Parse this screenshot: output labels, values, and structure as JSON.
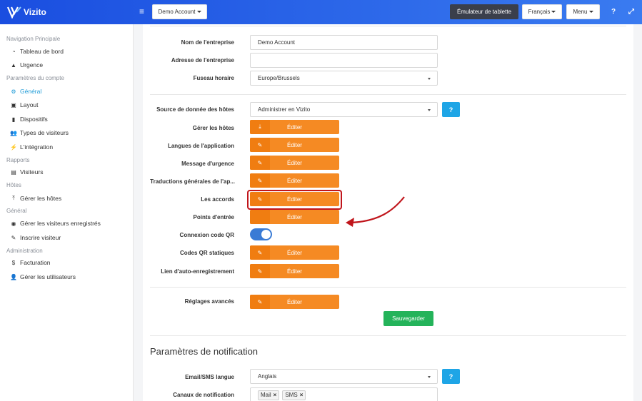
{
  "app": {
    "name": "Vizito"
  },
  "topbar": {
    "account_label": "Demo Account",
    "tablet_emulator_label": "Émulateur de tablette",
    "language_label": "Français",
    "menu_label": "Menu",
    "help_icon": "?",
    "expand_icon": "⤢",
    "hamburger_icon": "≡"
  },
  "sidebar": {
    "sections": [
      {
        "title": "Navigation Principale",
        "items": [
          {
            "label": "Tableau de bord",
            "icon": "dashboard-icon",
            "glyph": "◔"
          },
          {
            "label": "Urgence",
            "icon": "warning-icon",
            "glyph": "▲"
          }
        ]
      },
      {
        "title": "Paramètres du compte",
        "items": [
          {
            "label": "Général",
            "icon": "gear-icon",
            "glyph": "⚙",
            "active": true
          },
          {
            "label": "Layout",
            "icon": "image-icon",
            "glyph": "▣"
          },
          {
            "label": "Dispositifs",
            "icon": "tablet-icon",
            "glyph": "▮"
          },
          {
            "label": "Types de visiteurs",
            "icon": "users-icon",
            "glyph": "👥"
          },
          {
            "label": "L'intégration",
            "icon": "plug-icon",
            "glyph": "⚡"
          }
        ]
      },
      {
        "title": "Rapports",
        "items": [
          {
            "label": "Visiteurs",
            "icon": "book-icon",
            "glyph": "▤"
          }
        ]
      },
      {
        "title": "Hôtes",
        "items": [
          {
            "label": "Gérer les hôtes",
            "icon": "upload-icon",
            "glyph": "⤒"
          }
        ]
      },
      {
        "title": "Général",
        "items": [
          {
            "label": "Gérer les visiteurs enregistrés",
            "icon": "id-card-icon",
            "glyph": "◉"
          },
          {
            "label": "Inscrire visiteur",
            "icon": "pencil-icon",
            "glyph": "✎"
          }
        ]
      },
      {
        "title": "Administration",
        "items": [
          {
            "label": "Facturation",
            "icon": "dollar-icon",
            "glyph": "$"
          },
          {
            "label": "Gérer les utilisateurs",
            "icon": "user-plus-icon",
            "glyph": "👤"
          }
        ]
      }
    ]
  },
  "form": {
    "company_name": {
      "label": "Nom de l'entreprise",
      "value": "Demo Account"
    },
    "company_address": {
      "label": "Adresse de l'entreprise",
      "value": ""
    },
    "timezone": {
      "label": "Fuseau horaire",
      "value": "Europe/Brussels"
    },
    "host_data_source": {
      "label": "Source de donnée des hôtes",
      "value": "Administrer en Vizito",
      "help": "?"
    },
    "edit_rows": [
      {
        "label": "Gérer les hôtes",
        "button": "Éditer",
        "icon": "upload-icon",
        "glyph": "⤓"
      },
      {
        "label": "Langues de l'application",
        "button": "Éditer",
        "icon": "edit-icon",
        "glyph": "✎"
      },
      {
        "label": "Message d'urgence",
        "button": "Éditer",
        "icon": "edit-icon",
        "glyph": "✎"
      },
      {
        "label": "Traductions générales de l'ap...",
        "button": "Éditer",
        "icon": "edit-icon",
        "glyph": "✎"
      },
      {
        "label": "Les accords",
        "button": "Éditer",
        "icon": "edit-icon",
        "glyph": "✎"
      },
      {
        "label": "Points d'entrée",
        "button": "Éditer",
        "icon": "edit-icon",
        "glyph": ""
      }
    ],
    "qr_connection": {
      "label": "Connexion code QR",
      "enabled": true
    },
    "edit_rows_2": [
      {
        "label": "Codes QR statiques",
        "button": "Éditer",
        "icon": "edit-icon",
        "glyph": "✎"
      },
      {
        "label": "Lien d'auto-enregistrement",
        "button": "Éditer",
        "icon": "edit-icon",
        "glyph": "✎"
      }
    ],
    "advanced": {
      "label": "Réglages avancés",
      "button": "Éditer",
      "icon": "edit-icon",
      "glyph": "✎"
    },
    "save_label": "Sauvegarder"
  },
  "notifications": {
    "heading": "Paramètres de notification",
    "language": {
      "label": "Email/SMS langue",
      "value": "Anglais",
      "help": "?"
    },
    "channels": {
      "label": "Canaux de notification",
      "tags": [
        "Mail",
        "SMS"
      ]
    }
  },
  "colors": {
    "accent": "#f58a23",
    "primary": "#1a4ee0",
    "highlight": "#c0151b",
    "save": "#24b35a"
  }
}
